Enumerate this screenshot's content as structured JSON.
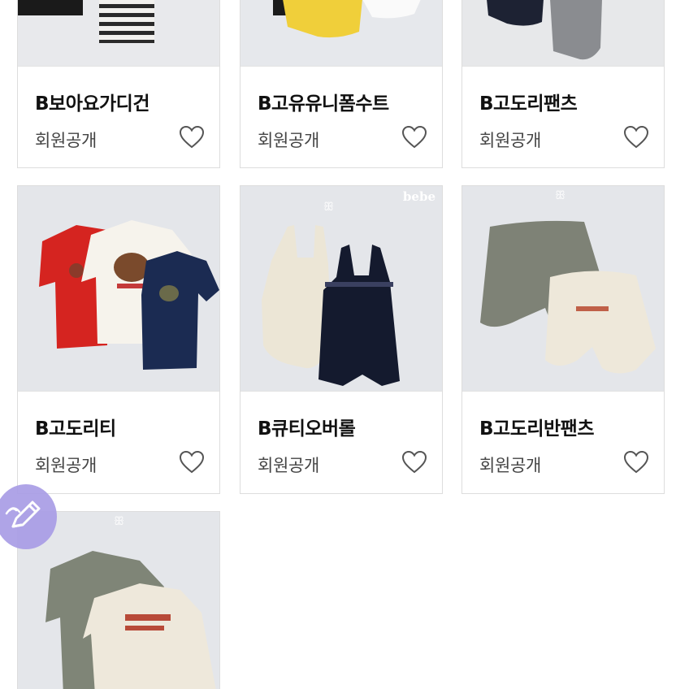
{
  "products": [
    {
      "name": "B보아요가디건",
      "price": "회원공개"
    },
    {
      "name": "B고유유니폼수트",
      "price": "회원공개"
    },
    {
      "name": "B고도리팬츠",
      "price": "회원공개"
    },
    {
      "name": "B고도리티",
      "price": "회원공개"
    },
    {
      "name": "B큐티오버롤",
      "price": "회원공개"
    },
    {
      "name": "B고도리반팬츠",
      "price": "회원공개"
    },
    {
      "name": "",
      "price": ""
    }
  ],
  "watermark": "bebe",
  "icons": {
    "wishlist": "heart-outline-icon",
    "fab": "pencil-icon"
  },
  "colors": {
    "fab": "#a99de6",
    "border": "#dddddd",
    "photo_bg": "#e6e8ec"
  }
}
